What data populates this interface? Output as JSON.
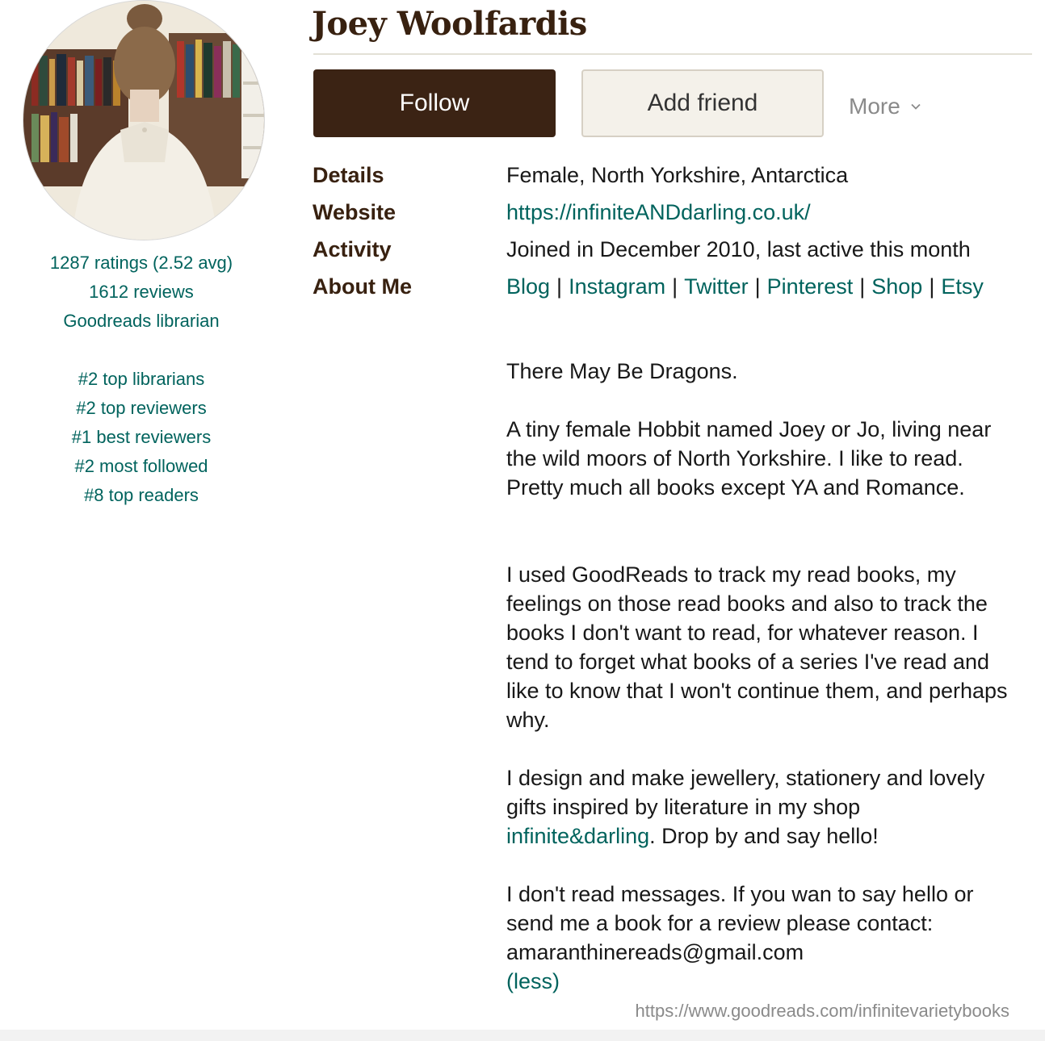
{
  "profile": {
    "name": "Joey Woolfardis",
    "avatar_icon": "profile-photo"
  },
  "stats": {
    "ratings": "1287 ratings (2.52 avg)",
    "reviews": "1612 reviews",
    "role": "Goodreads librarian",
    "ranks": [
      "#2 top librarians",
      "#2 top reviewers",
      "#1 best reviewers",
      "#2 most followed",
      "#8 top readers"
    ]
  },
  "actions": {
    "follow": "Follow",
    "add_friend": "Add friend",
    "more": "More"
  },
  "details": {
    "details_label": "Details",
    "details_value": "Female, North Yorkshire, Antarctica",
    "website_label": "Website",
    "website_value": "https://infiniteANDdarling.co.uk/",
    "activity_label": "Activity",
    "activity_value": "Joined in December 2010, last active this month",
    "about_label": "About Me",
    "about_links": [
      "Blog",
      "Instagram",
      "Twitter",
      "Pinterest",
      "Shop",
      "Etsy"
    ],
    "link_separator": "|"
  },
  "about": {
    "p1": "There May Be Dragons.",
    "p2": "A tiny female Hobbit named Joey or Jo, living near the wild moors of North Yorkshire. I like to read. Pretty much all books except YA and Romance.",
    "p3": "I used GoodReads to track my read books, my feelings on those read books and also to track the books I don't want to read, for whatever reason. I tend to forget what books of a series I've read and like to know that I won't continue them, and perhaps why.",
    "p4_before": "I design and make jewellery, stationery and lovely gifts inspired by literature in my shop ",
    "p4_link": "infinite&darling",
    "p4_after": ". Drop by and say hello!",
    "p5_line1": "I don't read messages. If you wan to say hello or send me a book for a review please contact:",
    "p5_email": "amaranthinereads@gmail.com",
    "less": "(less)"
  },
  "footer": {
    "url": "https://www.goodreads.com/infinitevarietybooks"
  },
  "colors": {
    "brand_brown": "#382110",
    "follow_bg": "#3b2314",
    "link_green": "#00635d",
    "add_friend_bg": "#f4f1ea"
  }
}
